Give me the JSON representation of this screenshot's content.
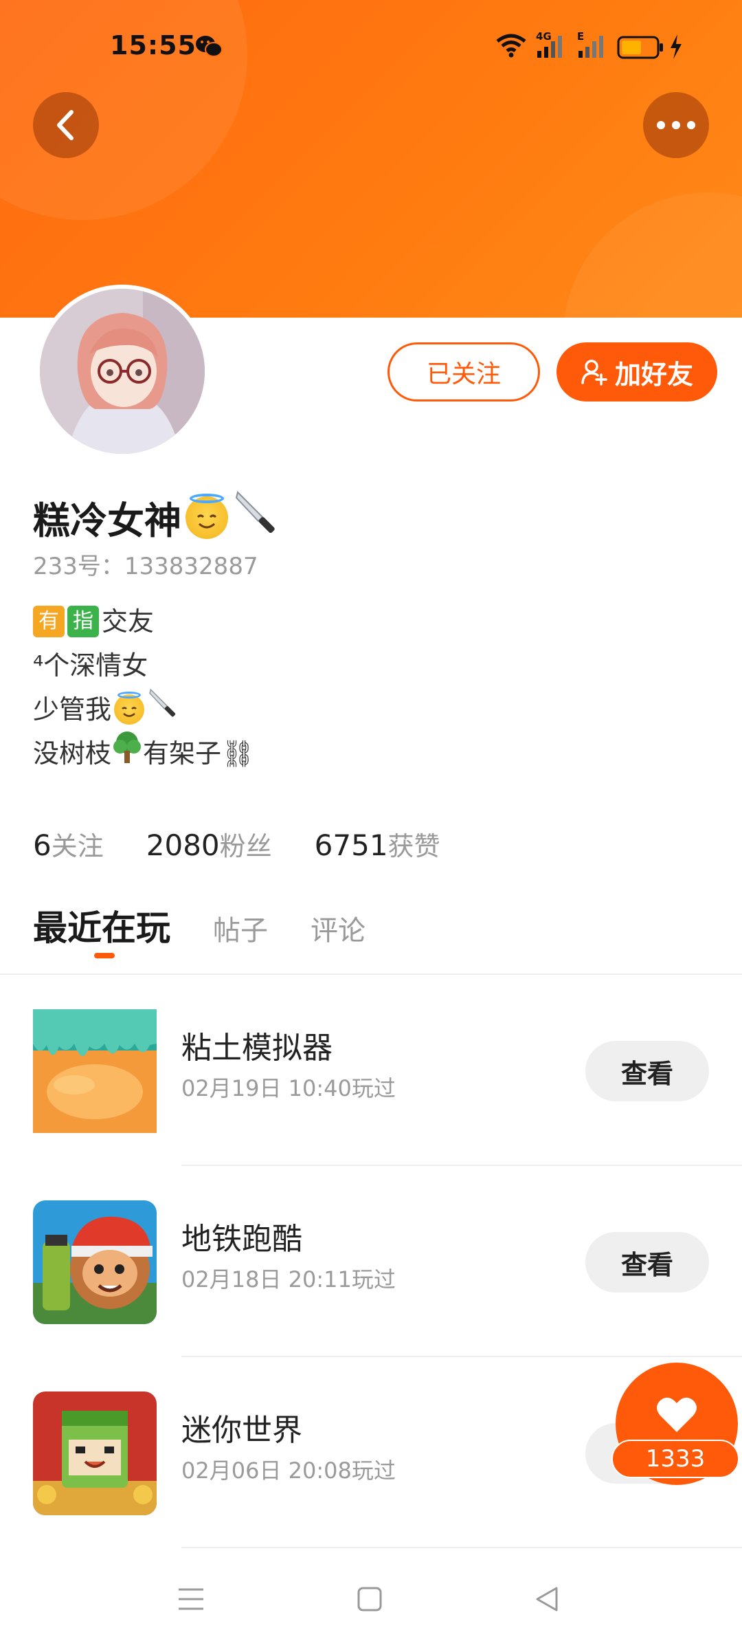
{
  "status_bar": {
    "time": "15:55",
    "signal1_label": "4G",
    "signal2_label": "E"
  },
  "header": {
    "back_icon": "chevron-left-icon",
    "more_icon": "more-dots-icon",
    "gradient_color": "#ff7a10"
  },
  "profile": {
    "username": "糕冷女神",
    "user_id": "233号：133832887",
    "follow_label": "已关注",
    "add_friend_label": "加好友",
    "bio": {
      "line1_tag1": "有",
      "line1_tag2": "指",
      "line1_text": "交友",
      "line2_text": "⁴个深情女",
      "line3_text": "少管我",
      "line4_text_a": "没树枝",
      "line4_text_b": "有架子⛓"
    }
  },
  "stats": {
    "following_count": "6",
    "following_label": "关注",
    "fans_count": "2080",
    "fans_label": "粉丝",
    "likes_count": "6751",
    "likes_label": "获赞"
  },
  "tabs": [
    {
      "label": "最近在玩",
      "active": true
    },
    {
      "label": "帖子",
      "active": false
    },
    {
      "label": "评论",
      "active": false
    }
  ],
  "games": [
    {
      "name": "粘土模拟器",
      "time": "02月19日 10:40玩过",
      "button": "查看"
    },
    {
      "name": "地铁跑酷",
      "time": "02月18日 20:11玩过",
      "button": "查看"
    },
    {
      "name": "迷你世界",
      "time": "02月06日 20:08玩过",
      "button": "查看"
    }
  ],
  "like_fab": {
    "count": "1333",
    "icon": "heart-icon"
  },
  "colors": {
    "accent": "#ff5a0a",
    "muted_text": "#9a9a9a"
  }
}
